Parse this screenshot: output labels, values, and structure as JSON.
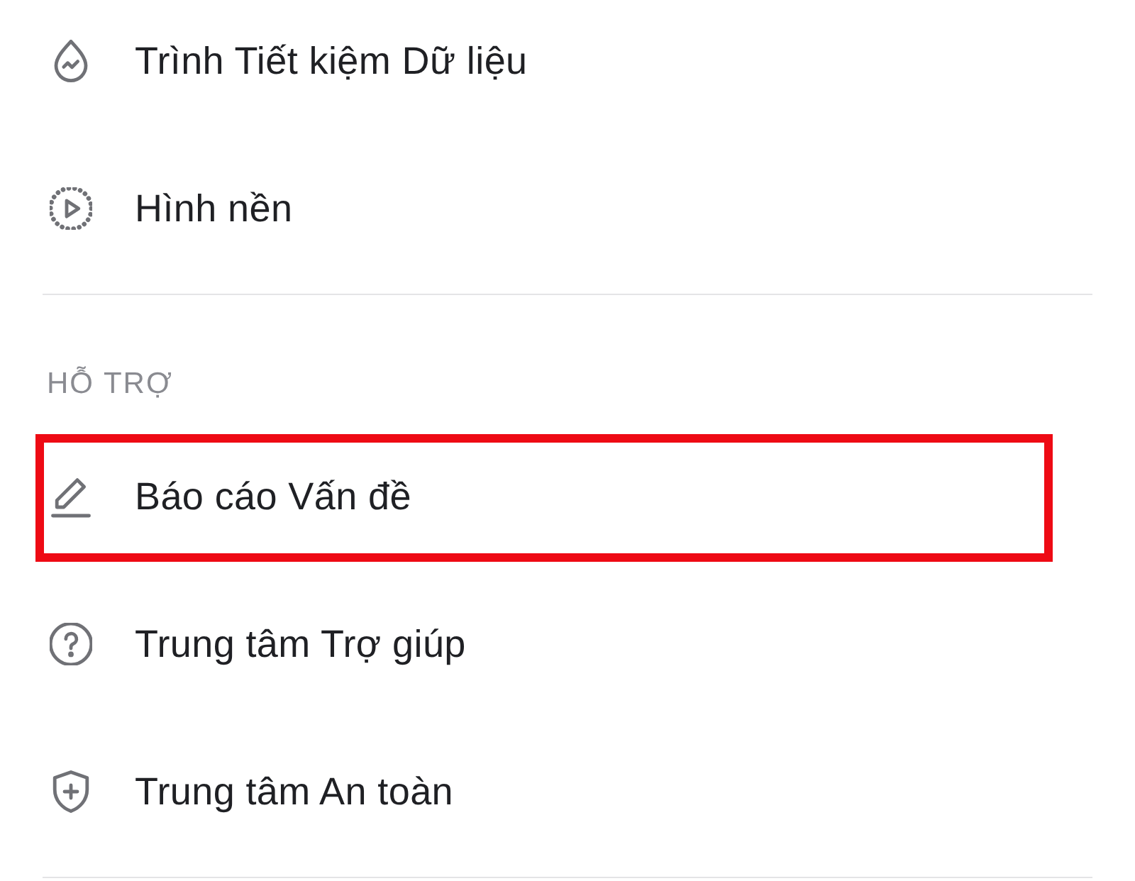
{
  "sections": [
    {
      "items": [
        {
          "label": "Trình Tiết kiệm Dữ liệu",
          "highlighted": false
        },
        {
          "label": "Hình nền",
          "highlighted": false
        }
      ]
    },
    {
      "header": "HỖ TRỢ",
      "items": [
        {
          "label": "Báo cáo Vấn đề",
          "highlighted": true
        },
        {
          "label": "Trung tâm Trợ giúp",
          "highlighted": false
        },
        {
          "label": "Trung tâm An toàn",
          "highlighted": false
        }
      ]
    }
  ]
}
